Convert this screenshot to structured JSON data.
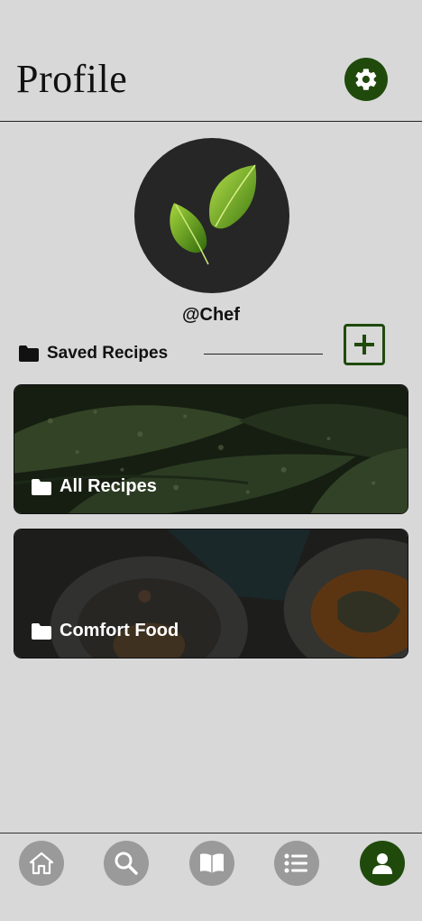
{
  "header": {
    "title": "Profile"
  },
  "profile": {
    "username": "@Chef"
  },
  "saved": {
    "section_label": "Saved Recipes",
    "folders": [
      {
        "label": "All Recipes"
      },
      {
        "label": "Comfort Food"
      }
    ]
  },
  "tabs": [
    {
      "icon": "home-icon",
      "active": false
    },
    {
      "icon": "search-icon",
      "active": false
    },
    {
      "icon": "book-icon",
      "active": false
    },
    {
      "icon": "list-icon",
      "active": false
    },
    {
      "icon": "user-icon",
      "active": true
    }
  ],
  "colors": {
    "accent": "#1f4a0c",
    "background": "#d8d8d8",
    "tab_inactive": "#9a9a9a"
  }
}
